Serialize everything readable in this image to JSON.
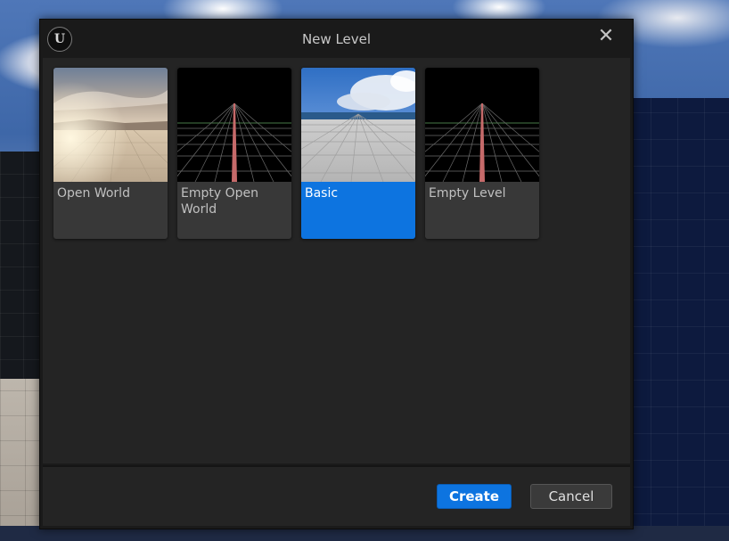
{
  "dialog": {
    "title": "New Level",
    "logo_text": "U",
    "close_symbol": "✕"
  },
  "templates": [
    {
      "label": "Open World",
      "thumbnail": "open-world-thumbnail",
      "selected": false
    },
    {
      "label": "Empty Open World",
      "thumbnail": "grid-thumbnail",
      "selected": false
    },
    {
      "label": "Basic",
      "thumbnail": "basic-thumbnail",
      "selected": true
    },
    {
      "label": "Empty Level",
      "thumbnail": "grid-thumbnail",
      "selected": false
    }
  ],
  "buttons": {
    "create": "Create",
    "cancel": "Cancel"
  },
  "colors": {
    "accent": "#0d74e0",
    "dialog_bg": "#242424",
    "tile_bg": "#383838"
  },
  "icons": {
    "logo": "unreal-logo-icon",
    "close": "close-icon"
  }
}
